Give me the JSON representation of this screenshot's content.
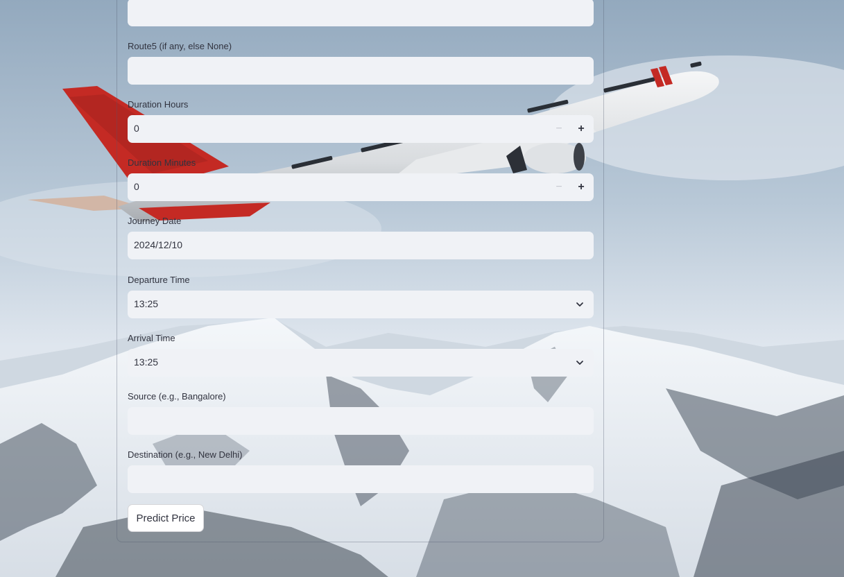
{
  "form": {
    "route4": {
      "value": ""
    },
    "route5": {
      "label": "Route5 (if any, else None)",
      "value": ""
    },
    "duration_hours": {
      "label": "Duration Hours",
      "value": "0",
      "minus": "−",
      "plus": "+"
    },
    "duration_minutes": {
      "label": "Duration Minutes",
      "value": "0",
      "minus": "−",
      "plus": "+"
    },
    "journey_date": {
      "label": "Journey Date",
      "value": "2024/12/10"
    },
    "departure_time": {
      "label": "Departure Time",
      "value": "13:25"
    },
    "arrival_time": {
      "label": "Arrival Time",
      "value": "13:25"
    },
    "source": {
      "label": "Source (e.g., Bangalore)",
      "value": ""
    },
    "destination": {
      "label": "Destination (e.g., New Delhi)",
      "value": ""
    },
    "predict_button": "Predict Price"
  },
  "icons": {
    "select_chevron": "chevron-down-icon",
    "stepper_minus": "minus-icon",
    "stepper_plus": "plus-icon"
  },
  "colors": {
    "field_background": "#f0f2f6",
    "text": "#31333f",
    "airline_red": "#c42a24"
  }
}
